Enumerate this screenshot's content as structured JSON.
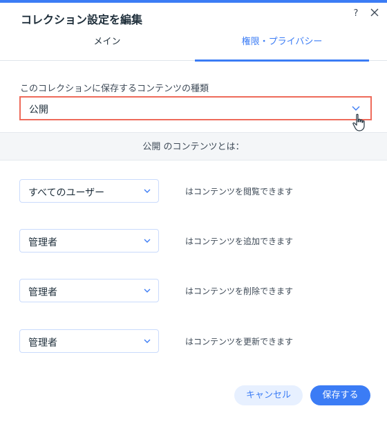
{
  "dialog": {
    "title": "コレクション設定を編集",
    "help_icon": "?",
    "close_icon": "close-icon"
  },
  "tabs": [
    {
      "label": "メイン",
      "active": false
    },
    {
      "label": "権限・プライバシー",
      "active": true
    }
  ],
  "content_type": {
    "label": "このコレクションに保存するコンテンツの種類",
    "value": "公開"
  },
  "section": {
    "heading": "公開 のコンテンツとは："
  },
  "permissions": [
    {
      "value": "すべてのユーザー",
      "description": "はコンテンツを閲覧できます"
    },
    {
      "value": "管理者",
      "description": "はコンテンツを追加できます"
    },
    {
      "value": "管理者",
      "description": "はコンテンツを削除できます"
    },
    {
      "value": "管理者",
      "description": "はコンテンツを更新できます"
    }
  ],
  "buttons": {
    "cancel": "キャンセル",
    "save": "保存する"
  },
  "colors": {
    "accent": "#3b7cf5",
    "highlight_border": "#ee6a5a",
    "text": "#20303c"
  }
}
